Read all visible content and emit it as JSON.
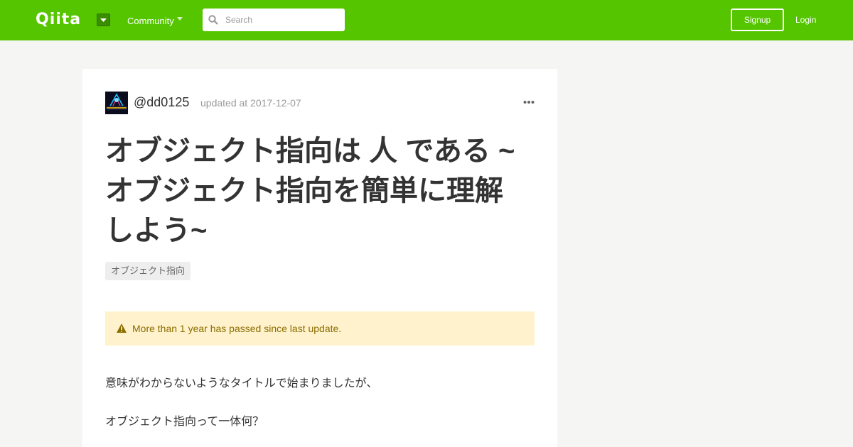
{
  "header": {
    "logo_text": "Qiita",
    "community_label": "Community",
    "search_placeholder": "Search",
    "signup_label": "Signup",
    "login_label": "Login",
    "brand_color": "#55c500"
  },
  "article": {
    "username": "@dd0125",
    "updated": "updated at 2017-12-07",
    "title_lines": [
      "オブジェクト指向は 人 である ~",
      "オブジェクト指向を簡単に理解",
      "しよう~"
    ],
    "tag": "オブジェクト指向",
    "alert_text": "More than 1 year has passed since last update.",
    "paragraphs": [
      "意味がわからないようなタイトルで始まりましたが、",
      "オブジェクト指向って一体何？"
    ],
    "icons": {
      "more": "more-horizontal-icon",
      "alert": "warning-icon",
      "search": "search-icon"
    }
  }
}
